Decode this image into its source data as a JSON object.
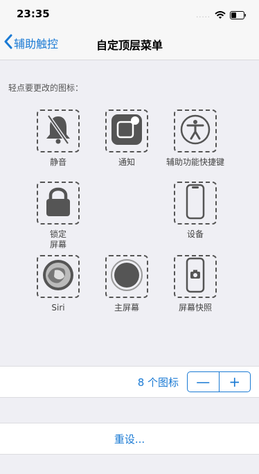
{
  "status": {
    "time": "23:35",
    "dots": "....."
  },
  "nav": {
    "back_label": "辅助触控",
    "title": "自定顶层菜单"
  },
  "hint": "轻点要更改的图标：",
  "icons": [
    {
      "label": "静音",
      "icon": "bell-slash-icon"
    },
    {
      "label": "通知",
      "icon": "notification-icon"
    },
    {
      "label": "辅助功能快捷键",
      "icon": "accessibility-icon"
    },
    {
      "label": "锁定\n屏幕",
      "icon": "lock-icon"
    },
    {
      "label": "设备",
      "icon": "iphone-icon"
    },
    {
      "label": "Siri",
      "icon": "siri-icon"
    },
    {
      "label": "主屏幕",
      "icon": "home-button-icon"
    },
    {
      "label": "屏幕快照",
      "icon": "screenshot-icon"
    }
  ],
  "counter": {
    "label": "8 个图标",
    "minus": "—",
    "plus": "+"
  },
  "reset_label": "重设...",
  "colors": {
    "accent": "#1a7ad4",
    "background": "#efeff4",
    "icon": "#555555"
  }
}
